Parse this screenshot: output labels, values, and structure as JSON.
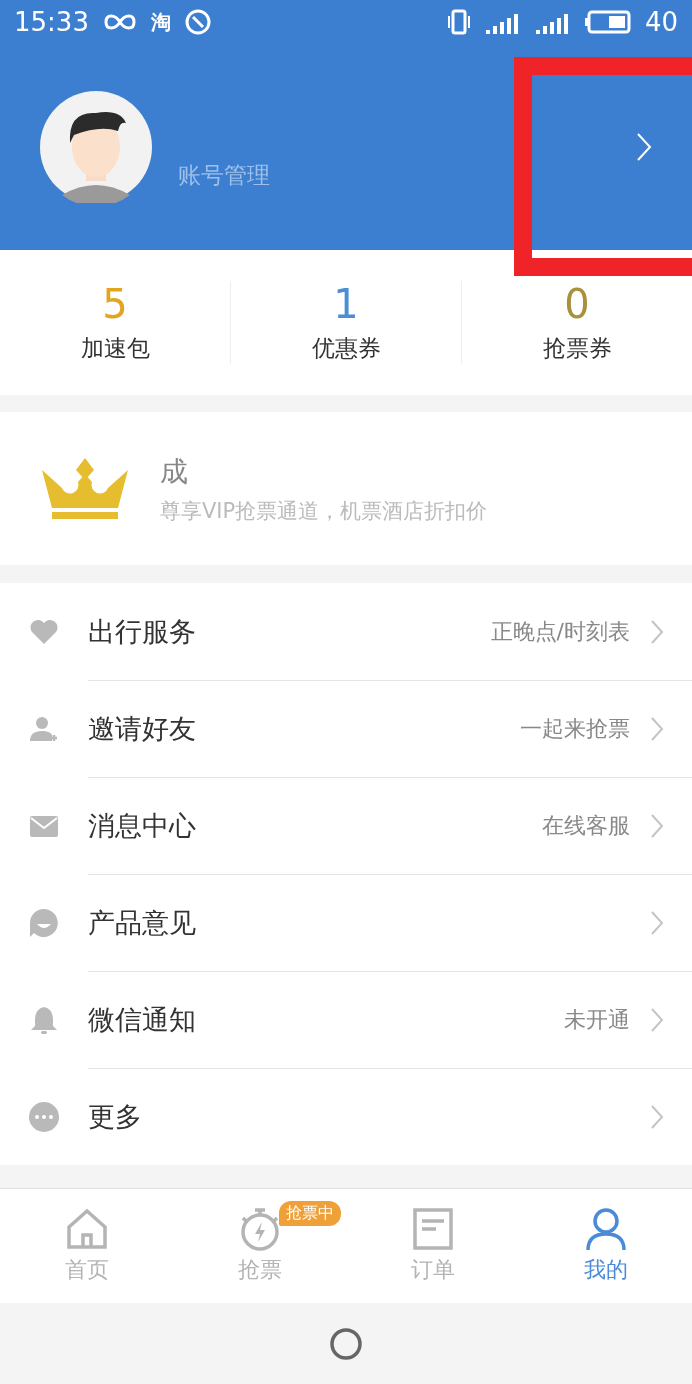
{
  "status_bar": {
    "time": "15:33",
    "app_glyph": "淘",
    "battery": "40"
  },
  "profile": {
    "subtitle": "账号管理",
    "highlighted": true
  },
  "stats": [
    {
      "value": "5",
      "label": "加速包",
      "color": "#e3a51f"
    },
    {
      "value": "1",
      "label": "优惠券",
      "color": "#4a8fd6"
    },
    {
      "value": "0",
      "label": "抢票券",
      "color": "#a8903c"
    }
  ],
  "vip": {
    "title": "成",
    "description": "尊享VIP抢票通道，机票酒店折扣价"
  },
  "menu": [
    {
      "kind": "heart",
      "label": "出行服务",
      "detail": "正晚点/时刻表"
    },
    {
      "kind": "invite",
      "label": "邀请好友",
      "detail": "一起来抢票"
    },
    {
      "kind": "mail",
      "label": "消息中心",
      "detail": "在线客服"
    },
    {
      "kind": "feedback",
      "label": "产品意见"
    },
    {
      "kind": "bell",
      "label": "微信通知",
      "detail": "未开通"
    },
    {
      "kind": "more",
      "label": "更多"
    }
  ],
  "tabs": [
    {
      "kind": "home",
      "label": "首页",
      "selected": false
    },
    {
      "kind": "timer",
      "label": "抢票",
      "selected": false,
      "badge": "抢票中"
    },
    {
      "kind": "order",
      "label": "订单",
      "selected": false
    },
    {
      "kind": "me",
      "label": "我的",
      "selected": true
    }
  ]
}
